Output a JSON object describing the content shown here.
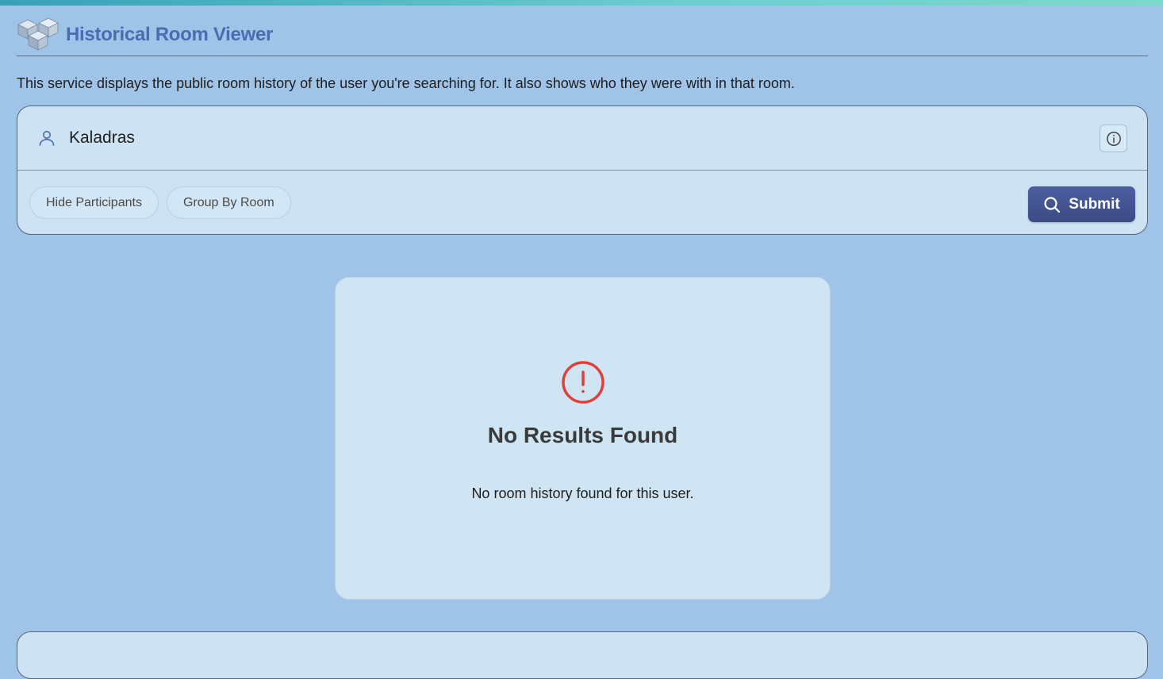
{
  "app": {
    "title": "Historical Room Viewer",
    "description": "This service displays the public room history of the user you're searching for. It also shows who they were with in that room."
  },
  "search": {
    "value": "Kaladras",
    "user_icon": "user-icon",
    "info_icon": "info-icon"
  },
  "options": {
    "hide_participants": "Hide Participants",
    "group_by_room": "Group By Room"
  },
  "submit": {
    "label": "Submit",
    "icon": "search-icon"
  },
  "result": {
    "title": "No Results Found",
    "message": "No room history found for this user.",
    "icon": "alert-circle-icon"
  },
  "colors": {
    "background": "#a0c4e8",
    "card": "#cde3f3",
    "accent": "#4a6cb0",
    "submit": "#4d5ea0",
    "alert": "#e0403a"
  }
}
